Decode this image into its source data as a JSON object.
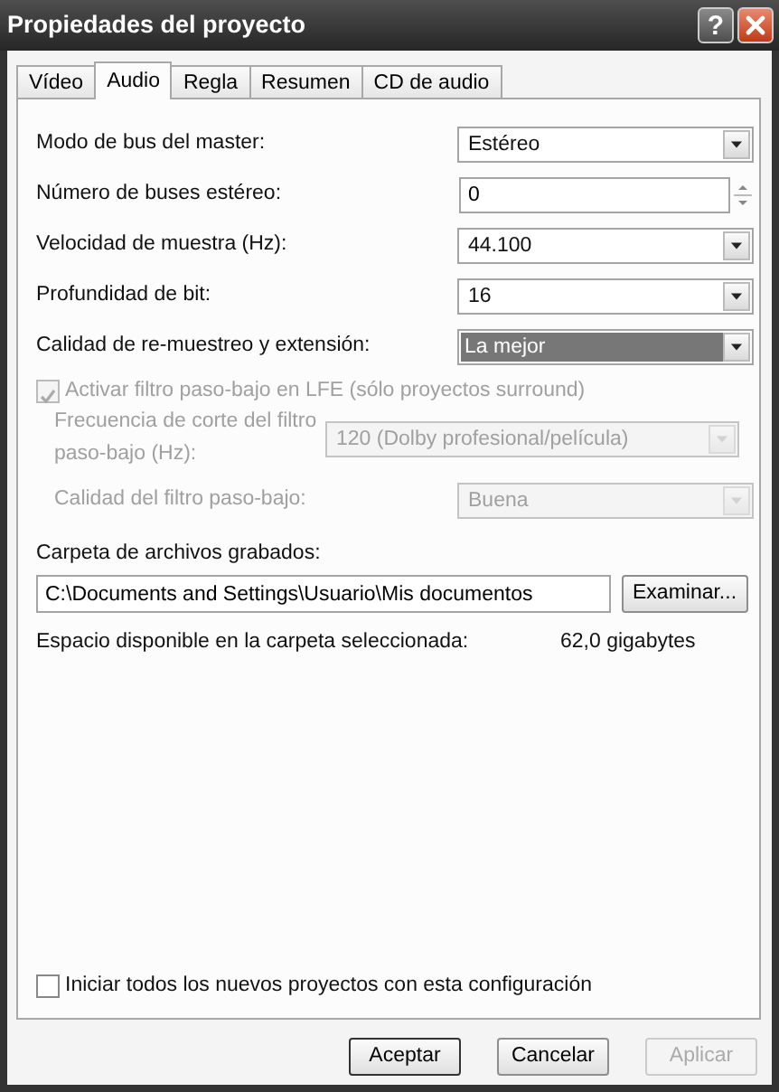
{
  "window": {
    "title": "Propiedades del proyecto",
    "help": "?"
  },
  "tabs": [
    {
      "label": "Vídeo",
      "selected": false
    },
    {
      "label": "Audio",
      "selected": true
    },
    {
      "label": "Regla",
      "selected": false
    },
    {
      "label": "Resumen",
      "selected": false
    },
    {
      "label": "CD de audio",
      "selected": false
    }
  ],
  "settings": [
    {
      "kind": "dropdown",
      "label": "Modo de bus del master:",
      "value": "Estéreo",
      "focused": false
    },
    {
      "kind": "spinner",
      "label": "Número de buses estéreo:",
      "value": "0",
      "focused": false
    },
    {
      "kind": "dropdown",
      "label": "Velocidad de muestra (Hz):",
      "value": "44.100",
      "focused": false
    },
    {
      "kind": "dropdown",
      "label": "Profundidad de bit:",
      "value": "16",
      "focused": false
    },
    {
      "kind": "dropdown",
      "label": "Calidad de re-muestreo y extensión:",
      "value": "La mejor",
      "focused": true
    }
  ],
  "lfe_checkbox": {
    "label": "Activar filtro paso-bajo en LFE (sólo proyectos surround)",
    "checked": true,
    "disabled": true
  },
  "lfe_settings": [
    {
      "label": "Frecuencia de corte del filtro paso-bajo (Hz):",
      "value": "120 (Dolby profesional/película)",
      "disabled": true
    },
    {
      "label": "Calidad del filtro paso-bajo:",
      "value": "Buena",
      "disabled": true
    }
  ],
  "folder": {
    "label": "Carpeta de archivos grabados:",
    "value": "C:\\Documents and Settings\\Usuario\\Mis documentos",
    "browse_button": "Examinar..."
  },
  "free_space": {
    "label": "Espacio disponible en la carpeta seleccionada:",
    "value": "62,0 gigabytes"
  },
  "startup_checkbox": {
    "label": "Iniciar todos los nuevos proyectos con esta configuración",
    "checked": false
  },
  "buttons": [
    {
      "label": "Aceptar",
      "default": true,
      "disabled": false
    },
    {
      "label": "Cancelar",
      "default": false,
      "disabled": false
    },
    {
      "label": "Aplicar",
      "default": false,
      "disabled": true
    }
  ]
}
